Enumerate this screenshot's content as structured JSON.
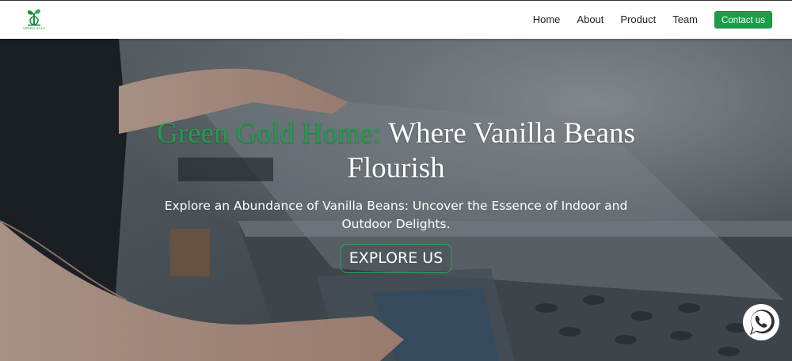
{
  "brand": {
    "logo_icon": "sprout-icon",
    "logo_text": "GREEN GOLD",
    "color": "#1a8a3a"
  },
  "nav": {
    "items": [
      {
        "label": "Home"
      },
      {
        "label": "About"
      },
      {
        "label": "Product"
      },
      {
        "label": "Team"
      }
    ],
    "cta_label": "Contact us",
    "cta_color": "#1a9e47"
  },
  "hero": {
    "title_highlight": "Green Gold Home:",
    "title_rest": " Where Vanilla Beans Flourish",
    "highlight_color": "#1f9e4a",
    "subtitle": "Explore an Abundance of Vanilla Beans: Uncover the Essence of Indoor and Outdoor Delights.",
    "button_label": "EXPLORE US"
  },
  "floating": {
    "icon": "whatsapp-icon",
    "color": "#ffffff"
  }
}
